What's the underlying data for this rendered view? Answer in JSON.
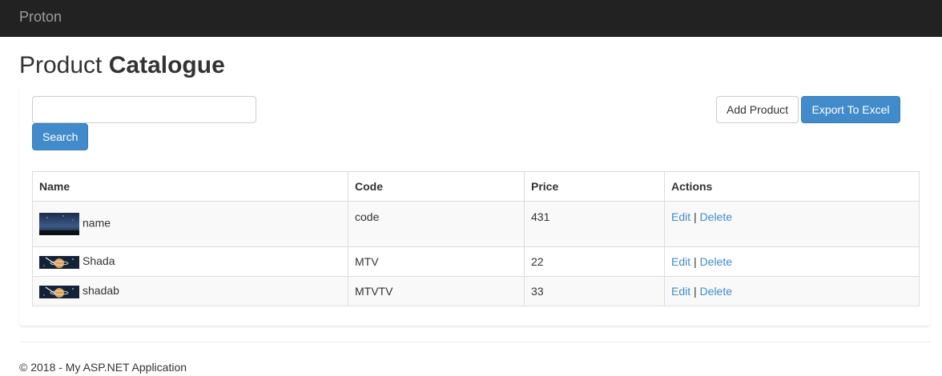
{
  "app": {
    "brand": "Proton"
  },
  "header": {
    "title_prefix": "Product ",
    "title_bold": "Catalogue"
  },
  "search": {
    "value": "",
    "placeholder": "",
    "button_label": "Search"
  },
  "toolbar": {
    "add_label": "Add Product",
    "export_label": "Export To Excel"
  },
  "table": {
    "columns": [
      "Name",
      "Code",
      "Price",
      "Actions"
    ],
    "rows": [
      {
        "name": "name",
        "code": "code",
        "price": "431",
        "thumbnail_icon": "night-sky-thumbnail",
        "edit": "Edit",
        "separator": "|",
        "delete": "Delete"
      },
      {
        "name": "Shada",
        "code": "MTV",
        "price": "22",
        "thumbnail_icon": "planet-thumbnail",
        "edit": "Edit",
        "separator": "|",
        "delete": "Delete"
      },
      {
        "name": "shadab",
        "code": "MTVTV",
        "price": "33",
        "thumbnail_icon": "planet-thumbnail",
        "edit": "Edit",
        "separator": "|",
        "delete": "Delete"
      }
    ]
  },
  "footer": {
    "text": "© 2018 - My ASP.NET Application"
  },
  "colors": {
    "navbar": "#222222",
    "brand_text": "#9d9d9d",
    "primary": "#428bca",
    "link": "#428bca",
    "stripe": "#f9f9f9",
    "border": "#dddddd"
  }
}
